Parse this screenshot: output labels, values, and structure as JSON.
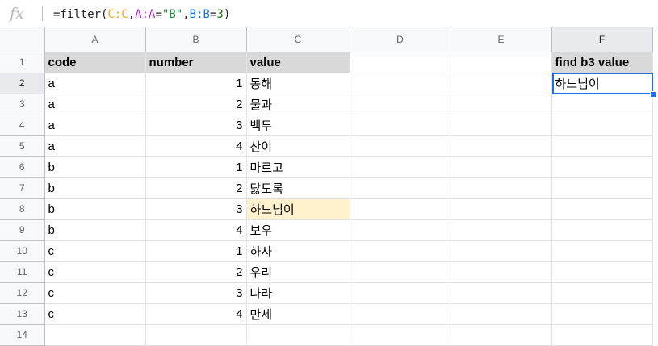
{
  "formula": {
    "parts": [
      {
        "text": "=filter(",
        "cls": ""
      },
      {
        "text": "C:C",
        "cls": "fc"
      },
      {
        "text": ",",
        "cls": ""
      },
      {
        "text": "A:A",
        "cls": "fa"
      },
      {
        "text": "=",
        "cls": ""
      },
      {
        "text": "\"B\"",
        "cls": "fs"
      },
      {
        "text": ",",
        "cls": ""
      },
      {
        "text": "B:B",
        "cls": "fb"
      },
      {
        "text": "=",
        "cls": ""
      },
      {
        "text": "3",
        "cls": "fd"
      },
      {
        "text": ")",
        "cls": ""
      }
    ]
  },
  "icons": {
    "fx": "fx"
  },
  "columns": [
    "A",
    "B",
    "C",
    "D",
    "E",
    "F"
  ],
  "rows": [
    {
      "n": "1",
      "a": "code",
      "b": "number",
      "c": "value",
      "f": "find b3 value"
    },
    {
      "n": "2",
      "a": "a",
      "b": "1",
      "c": "동해",
      "f": "하느님이"
    },
    {
      "n": "3",
      "a": "a",
      "b": "2",
      "c": "물과",
      "f": ""
    },
    {
      "n": "4",
      "a": "a",
      "b": "3",
      "c": "백두",
      "f": ""
    },
    {
      "n": "5",
      "a": "a",
      "b": "4",
      "c": "산이",
      "f": ""
    },
    {
      "n": "6",
      "a": "b",
      "b": "1",
      "c": "마르고",
      "f": ""
    },
    {
      "n": "7",
      "a": "b",
      "b": "2",
      "c": "닳도록",
      "f": ""
    },
    {
      "n": "8",
      "a": "b",
      "b": "3",
      "c": "하느님이",
      "f": ""
    },
    {
      "n": "9",
      "a": "b",
      "b": "4",
      "c": "보우",
      "f": ""
    },
    {
      "n": "10",
      "a": "c",
      "b": "1",
      "c": "하사",
      "f": ""
    },
    {
      "n": "11",
      "a": "c",
      "b": "2",
      "c": "우리",
      "f": ""
    },
    {
      "n": "12",
      "a": "c",
      "b": "3",
      "c": "나라",
      "f": ""
    },
    {
      "n": "13",
      "a": "c",
      "b": "4",
      "c": "만세",
      "f": ""
    },
    {
      "n": "14",
      "a": "",
      "b": "",
      "c": "",
      "f": ""
    }
  ],
  "colors": {
    "header_fill": "#d9d9d9",
    "highlight_fill": "#fff2cc",
    "selection": "#1a73e8"
  }
}
